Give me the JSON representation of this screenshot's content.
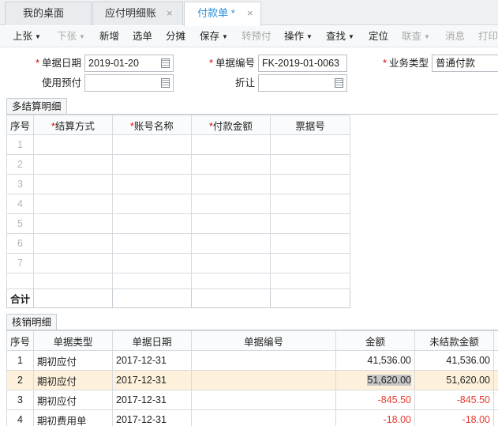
{
  "tabs": [
    {
      "label": "我的桌面"
    },
    {
      "label": "应付明细账"
    },
    {
      "label": "付款单 *"
    }
  ],
  "tab_close": "×",
  "toolbar": [
    {
      "label": "上张",
      "caret": "▼",
      "enabled": true
    },
    {
      "label": "下张",
      "caret": "▼",
      "enabled": false
    },
    {
      "label": "新增",
      "enabled": true
    },
    {
      "label": "选单",
      "enabled": true
    },
    {
      "label": "分摊",
      "enabled": true
    },
    {
      "label": "保存",
      "caret": "▼",
      "enabled": true
    },
    {
      "label": "转预付",
      "enabled": false
    },
    {
      "label": "操作",
      "caret": "▼",
      "enabled": true
    },
    {
      "label": "查找",
      "caret": "▼",
      "enabled": true
    },
    {
      "label": "定位",
      "enabled": true
    },
    {
      "label": "联查",
      "caret": "▼",
      "enabled": false
    },
    {
      "label": "消息",
      "enabled": false
    },
    {
      "label": "打印",
      "enabled": false
    }
  ],
  "form": {
    "required_mark": "*",
    "doc_date_label": "单据日期",
    "doc_date": "2019-01-20",
    "doc_no_label": "单据编号",
    "doc_no": "FK-2019-01-0063",
    "biz_type_label": "业务类型",
    "biz_type": "普通付款",
    "use_prepay_label": "使用预付",
    "use_prepay": "",
    "discount_label": "折让",
    "discount": ""
  },
  "settlement": {
    "tab_label": "多结算明细",
    "columns": [
      "序号",
      "结算方式",
      "账号名称",
      "付款金额",
      "票据号"
    ],
    "required_cols": [
      false,
      true,
      true,
      true,
      false
    ],
    "rows": [
      "1",
      "2",
      "3",
      "4",
      "5",
      "6",
      "7"
    ],
    "total_label": "合计"
  },
  "writeoff": {
    "tab_label": "核销明细",
    "columns": [
      "序号",
      "单据类型",
      "单据日期",
      "单据编号",
      "金额",
      "未结款金额"
    ],
    "rows": [
      {
        "no": "1",
        "type": "期初应付",
        "date": "2017-12-31",
        "code": "",
        "amount": "41,536.00",
        "unpaid": "41,536.00",
        "negative": false
      },
      {
        "no": "2",
        "type": "期初应付",
        "date": "2017-12-31",
        "code": "",
        "amount": "51,620.00",
        "unpaid": "51,620.00",
        "negative": false
      },
      {
        "no": "3",
        "type": "期初应付",
        "date": "2017-12-31",
        "code": "",
        "amount": "-845.50",
        "unpaid": "-845.50",
        "negative": true
      },
      {
        "no": "4",
        "type": "期初费用单",
        "date": "2017-12-31",
        "code": "",
        "amount": "-18.00",
        "unpaid": "-18.00",
        "negative": true
      }
    ]
  }
}
